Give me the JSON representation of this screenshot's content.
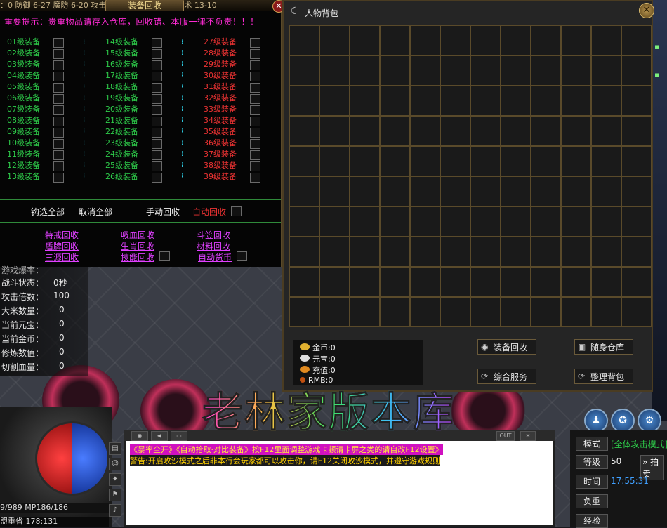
{
  "recycle_panel": {
    "topbar_text": "：0 防御 6-27 魔防 6-20 攻击 13-37 魔法 13-10 道术 13-10",
    "title": "装备回收",
    "close_label": "✕",
    "notice": "重要提示：贵重物品请存入仓库，回收错、本服一律不负责！！！",
    "col1": [
      "01级装备",
      "02级装备",
      "03级装备",
      "04级装备",
      "05级装备",
      "06级装备",
      "07级装备",
      "08级装备",
      "09级装备",
      "10级装备",
      "11级装备",
      "12级装备",
      "13级装备"
    ],
    "col2": [
      "14级装备",
      "15级装备",
      "16级装备",
      "17级装备",
      "18级装备",
      "19级装备",
      "20级装备",
      "21级装备",
      "22级装备",
      "23级装备",
      "24级装备",
      "25级装备",
      "26级装备"
    ],
    "col3": [
      "27级装备",
      "28级装备",
      "29级装备",
      "30级装备",
      "31级装备",
      "32级装备",
      "33级装备",
      "34级装备",
      "35级装备",
      "36级装备",
      "37级装备",
      "38级装备",
      "39级装备"
    ],
    "select_all": "钩选全部",
    "cancel_all": "取消全部",
    "manual_recycle": "手动回收",
    "auto_recycle": "自动回收",
    "links": {
      "ring": "特戒回收",
      "shield": "盾牌回收",
      "sanyuan": "三源回收",
      "blood": "吸血回收",
      "zodiac": "生肖回收",
      "skill": "技能回收",
      "douli": "斗笠回收",
      "material": "材料回收",
      "auto_coin": "自动货币"
    }
  },
  "stats": {
    "partial_row": "游戏爆率：",
    "battle_state": {
      "label": "战斗状态：",
      "value": "0秒"
    },
    "attack_mult": {
      "label": "攻击倍数：",
      "value": "100"
    },
    "rice": {
      "label": "大米数量：",
      "value": "0"
    },
    "yuanbao": {
      "label": "当前元宝：",
      "value": "0"
    },
    "gold": {
      "label": "当前金币：",
      "value": "0"
    },
    "refine": {
      "label": "修炼数值：",
      "value": "0"
    },
    "cut_blood": {
      "label": "切割血量：",
      "value": "0"
    }
  },
  "inventory": {
    "title": "人物背包",
    "money": {
      "gold": "金币:0",
      "yuanbao": "元宝:0",
      "recharge": "充值:0",
      "rmb": "RMB:0"
    },
    "buttons": {
      "recycle": "装备回收",
      "warehouse": "随身仓库",
      "service": "综合服务",
      "sort": "整理背包"
    }
  },
  "hud": {
    "hp_mp": "9/989        MP186/186",
    "location": "盟重省 178:131",
    "chat_line1": "《暴率全开》《自动拾取·对比装备》按F12里面调整游戏卡顿请卡屏之类的请自改F12设置》",
    "chat_line2": "警告:开启攻沙模式之后非本行会玩家都可以攻击你，请F12关闭攻沙模式，并遵守游戏规则",
    "chat_out": "OUT",
    "chat_close": "✕",
    "watermark": "老林家版本库",
    "mode_label": "模式",
    "mode_value": "[全体攻击模式]",
    "level_label": "等级",
    "level_value": "50",
    "time_label": "时间",
    "time_value": "17:55:31",
    "weight_label": "负重",
    "exp_label": "经验",
    "pick_label": "拍卖"
  },
  "colors": {
    "green_text": "#2ecc4a",
    "red_text": "#e33",
    "magenta_link": "#e040ff",
    "notice_pink": "#ff2bd5",
    "panel_border": "#5a4a2a"
  }
}
